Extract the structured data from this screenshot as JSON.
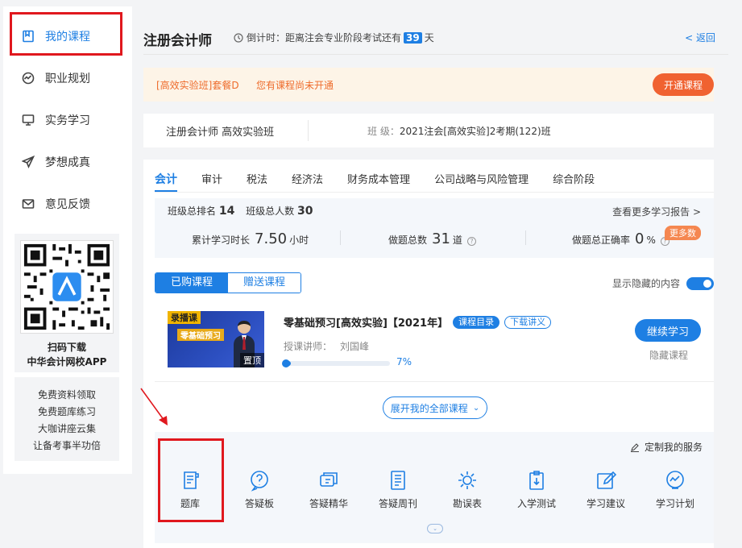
{
  "sidebar": {
    "items": [
      {
        "label": "我的课程",
        "icon": "book-icon",
        "active": true
      },
      {
        "label": "职业规划",
        "icon": "chart-icon"
      },
      {
        "label": "实务学习",
        "icon": "monitor-icon"
      },
      {
        "label": "梦想成真",
        "icon": "paper-plane-icon"
      },
      {
        "label": "意见反馈",
        "icon": "mail-icon"
      }
    ],
    "qr": {
      "line1": "扫码下载",
      "line2": "中华会计网校APP"
    },
    "links": [
      "免费资料领取",
      "免费题库练习",
      "大咖讲座云集",
      "让备考事半功倍"
    ]
  },
  "header": {
    "title": "注册会计师",
    "countdown_prefix": "倒计时：距离注会专业阶段考试还有",
    "countdown_days": "39",
    "countdown_suffix": "天",
    "back": "< 返回"
  },
  "notice": {
    "package": "[高效实验班]套餐D",
    "message": "您有课程尚未开通",
    "button": "开通课程"
  },
  "class_info": {
    "name": "注册会计师 高效实验班",
    "class_label": "班 级：",
    "class_value": "2021注会[高效实验]2考期(122)班"
  },
  "tabs": [
    "会计",
    "审计",
    "税法",
    "经济法",
    "财务成本管理",
    "公司战略与风险管理",
    "综合阶段"
  ],
  "stats": {
    "rank_label": "班级总排名",
    "rank_value": "14",
    "total_label": "班级总人数",
    "total_value": "30",
    "report_link": "查看更多学习报告 >",
    "study_label": "累计学习时长",
    "study_value": "7.50",
    "study_unit": "小时",
    "questions_label": "做题总数",
    "questions_value": "31",
    "questions_unit": "道",
    "accuracy_label": "做题总正确率",
    "accuracy_value": "0",
    "accuracy_unit": "%",
    "more_badge": "更多数"
  },
  "course_filter": {
    "bought": "已购课程",
    "gifted": "赠送课程",
    "show_hidden": "显示隐藏的内容"
  },
  "course": {
    "thumb_badge": "录播课",
    "thumb_title": "零基础预习",
    "thumb_pin": "置顶",
    "title": "零基础预习[高效实验]【2021年】",
    "catalog": "课程目录",
    "handout": "下载讲义",
    "teacher_label": "授课讲师：",
    "teacher_name": "刘国峰",
    "progress": 0.07,
    "progress_text": "7%",
    "continue": "继续学习",
    "hide": "隐藏课程"
  },
  "expand_all": "展开我的全部课程",
  "services": {
    "custom": "定制我的服务",
    "items": [
      {
        "label": "题库",
        "icon": "question-bank-icon"
      },
      {
        "label": "答疑板",
        "icon": "question-board-icon"
      },
      {
        "label": "答疑精华",
        "icon": "qa-essence-icon"
      },
      {
        "label": "答疑周刊",
        "icon": "weekly-icon"
      },
      {
        "label": "勘误表",
        "icon": "errata-icon"
      },
      {
        "label": "入学测试",
        "icon": "entrance-test-icon"
      },
      {
        "label": "学习建议",
        "icon": "study-advice-icon"
      },
      {
        "label": "学习计划",
        "icon": "study-plan-icon"
      }
    ]
  },
  "colors": {
    "accent": "#1e7fe3",
    "orange": "#f06231",
    "highlight": "#e0181e"
  }
}
